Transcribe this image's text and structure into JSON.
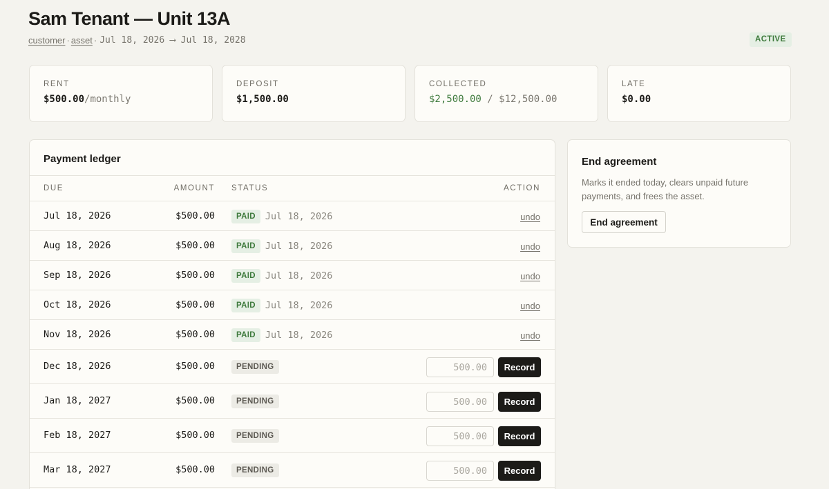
{
  "header": {
    "title": "Sam Tenant — Unit 13A",
    "crumb_customer": "customer",
    "crumb_asset": "asset",
    "separator": "·",
    "date_range": "Jul 18, 2026 ⟶ Jul 18, 2028",
    "status_badge": "ACTIVE"
  },
  "stats": {
    "rent": {
      "label": "RENT",
      "value": "$500.00",
      "suffix": "/monthly"
    },
    "deposit": {
      "label": "DEPOSIT",
      "value": "$1,500.00"
    },
    "collected": {
      "label": "COLLECTED",
      "value": "$2,500.00",
      "separator": " / ",
      "total": "$12,500.00"
    },
    "late": {
      "label": "LATE",
      "value": "$0.00"
    }
  },
  "ledger": {
    "title": "Payment ledger",
    "columns": {
      "due": "DUE",
      "amount": "AMOUNT",
      "status": "STATUS",
      "action": "ACTION"
    },
    "rows": [
      {
        "due": "Jul 18, 2026",
        "amount": "$500.00",
        "status": "PAID",
        "paid_on": "Jul 18, 2026",
        "action": "undo"
      },
      {
        "due": "Aug 18, 2026",
        "amount": "$500.00",
        "status": "PAID",
        "paid_on": "Jul 18, 2026",
        "action": "undo"
      },
      {
        "due": "Sep 18, 2026",
        "amount": "$500.00",
        "status": "PAID",
        "paid_on": "Jul 18, 2026",
        "action": "undo"
      },
      {
        "due": "Oct 18, 2026",
        "amount": "$500.00",
        "status": "PAID",
        "paid_on": "Jul 18, 2026",
        "action": "undo"
      },
      {
        "due": "Nov 18, 2026",
        "amount": "$500.00",
        "status": "PAID",
        "paid_on": "Jul 18, 2026",
        "action": "undo"
      },
      {
        "due": "Dec 18, 2026",
        "amount": "$500.00",
        "status": "PENDING",
        "input_placeholder": "500.00",
        "action": "Record"
      },
      {
        "due": "Jan 18, 2027",
        "amount": "$500.00",
        "status": "PENDING",
        "input_placeholder": "500.00",
        "action": "Record"
      },
      {
        "due": "Feb 18, 2027",
        "amount": "$500.00",
        "status": "PENDING",
        "input_placeholder": "500.00",
        "action": "Record"
      },
      {
        "due": "Mar 18, 2027",
        "amount": "$500.00",
        "status": "PENDING",
        "input_placeholder": "500.00",
        "action": "Record"
      }
    ]
  },
  "end_agreement": {
    "title": "End agreement",
    "description": "Marks it ended today, clears unpaid future payments, and frees the asset.",
    "button_label": "End agreement"
  },
  "colors": {
    "background": "#f4f3ee",
    "card": "#fdfcf8",
    "accent_green": "#3e7a3c",
    "paid_badge_bg": "#e5efe4",
    "button_dark": "#1c1b18"
  }
}
